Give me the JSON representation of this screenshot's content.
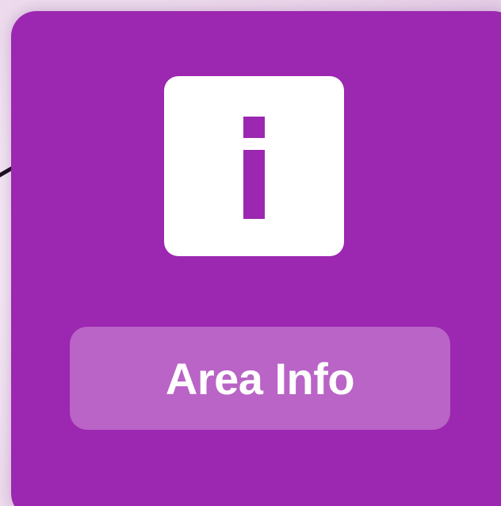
{
  "card": {
    "icon": "info-icon",
    "button_label": "Area Info"
  },
  "colors": {
    "card_background": "#9c27b0",
    "icon_tile": "#ffffff",
    "button_background": "#b964c6",
    "button_text": "#ffffff",
    "connector_line": "#1b1020"
  }
}
